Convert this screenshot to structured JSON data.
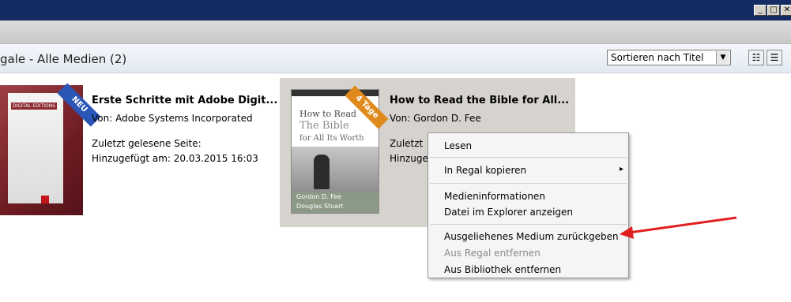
{
  "window": {
    "minimize_glyph": "_",
    "maximize_glyph": "□",
    "close_glyph": "✕"
  },
  "header": {
    "title": "gale - Alle Medien (2)",
    "sort_select": "Sortieren nach Titel",
    "dropdown_glyph": "▼",
    "view_detail_glyph": "☷",
    "view_list_glyph": "☰"
  },
  "books": [
    {
      "title": "Erste Schritte mit Adobe Digit...",
      "author_line": "Von:  Adobe Systems Incorporated",
      "last_page": "Zuletzt gelesene Seite:",
      "added": "Hinzugefügt am:  20.03.2015 16:03",
      "badge": "NEU",
      "badge_color": "#2a56b8",
      "cover_text": "DIGITAL EDITIONS"
    },
    {
      "title": "How to Read the Bible for All...",
      "author_line": "Von:  Gordon D. Fee",
      "last_page_partial": "Zuletzt",
      "added_partial": "Hinzuge",
      "badge": "4 Tage",
      "badge_color": "#e08a1e",
      "cover": {
        "line1": "How to Read",
        "line2": "The Bible",
        "line3": "for All Its Worth",
        "authors_line1": "Gordon D. Fee",
        "authors_line2": "Douglas Stuart"
      }
    }
  ],
  "context_menu": {
    "items": [
      {
        "label": "Lesen"
      },
      {
        "label": "In Regal kopieren",
        "submenu_glyph": "▸"
      },
      {
        "label": "Medieninformationen"
      },
      {
        "label": "Datei im Explorer anzeigen"
      },
      {
        "label": "Ausgeliehenes Medium zurückgeben"
      },
      {
        "label": "Aus Regal entfernen",
        "disabled": true
      },
      {
        "label": "Aus Bibliothek entfernen"
      }
    ]
  },
  "annotation": {
    "arrow_color": "#e02020"
  }
}
